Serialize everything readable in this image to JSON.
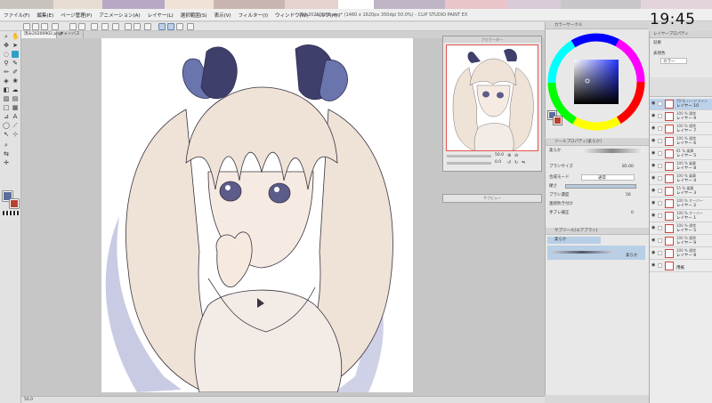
{
  "app": {
    "title": "済み20200902.png* (1460 x 1620px 350dpi 50.0%) - CLIP STUDIO PAINT EX",
    "clock": "19:45"
  },
  "menu": {
    "items": [
      "ファイル(F)",
      "編集(E)",
      "ページ管理(P)",
      "アニメーション(A)",
      "レイヤー(L)",
      "選択範囲(S)",
      "表示(V)",
      "フィルター(I)",
      "ウィンドウ(W)",
      "ヘルプ(H)"
    ]
  },
  "tabs": [
    {
      "label": "済み20200902.png*"
    },
    {
      "label": "キャンバス"
    }
  ],
  "navigator": {
    "title": "ナビゲーター",
    "zoom": "50.0",
    "angle": "0.0"
  },
  "sub_window_title": "サブビュー",
  "color_panel": {
    "title": "カラーサークル",
    "main_color": "#5b6d9e",
    "sub_color": "#b8412f"
  },
  "tool_property": {
    "title": "ツールプロパティ[柔らか]",
    "tool_name": "柔らか",
    "brush_size_label": "ブラシサイズ",
    "brush_size_value": "85.00",
    "blend_label": "合成モード",
    "blend_value": "通常",
    "hardness_label": "硬さ",
    "density_label": "ブラシ濃度",
    "density_value": "56",
    "continuous_label": "連続吹き付け",
    "stabilize_label": "手ブレ補正",
    "stabilize_value": "0"
  },
  "sub_tool": {
    "title": "サブツール[エアブラシ]",
    "group_label": "柔らか",
    "item_label": "柔らか"
  },
  "layer_property": {
    "title": "レイヤープロパティ",
    "effect_label": "効果",
    "expression_label": "表現色",
    "expression_value": "カラー"
  },
  "layers": [
    {
      "mode": "70 % ハードライト",
      "name": "レイヤー 10",
      "selected": true
    },
    {
      "mode": "100 % 通常",
      "name": "レイヤー 9",
      "selected": false
    },
    {
      "mode": "100 % 通常",
      "name": "レイヤー 7",
      "selected": false
    },
    {
      "mode": "100 % 通常",
      "name": "レイヤー 6",
      "selected": false
    },
    {
      "mode": "81 % 乗算",
      "name": "レイヤー 5",
      "selected": false
    },
    {
      "mode": "100 % 乗算",
      "name": "レイヤー 8",
      "selected": false
    },
    {
      "mode": "100 % 乗算",
      "name": "レイヤー 4",
      "selected": false
    },
    {
      "mode": "55 % 乗算",
      "name": "レイヤー 3",
      "selected": false
    },
    {
      "mode": "100 % オーバー",
      "name": "レイヤー 2",
      "selected": false
    },
    {
      "mode": "100 % オーバー",
      "name": "レイヤー 1",
      "selected": false
    },
    {
      "mode": "100 % 通常",
      "name": "レイヤー 5",
      "selected": false
    },
    {
      "mode": "100 % 通常",
      "name": "レイヤー 9",
      "selected": false
    },
    {
      "mode": "100 % 通常",
      "name": "レイヤー 8",
      "selected": false
    },
    {
      "mode": "",
      "name": "用紙",
      "selected": false
    }
  ],
  "status": {
    "zoom": "50.0"
  }
}
